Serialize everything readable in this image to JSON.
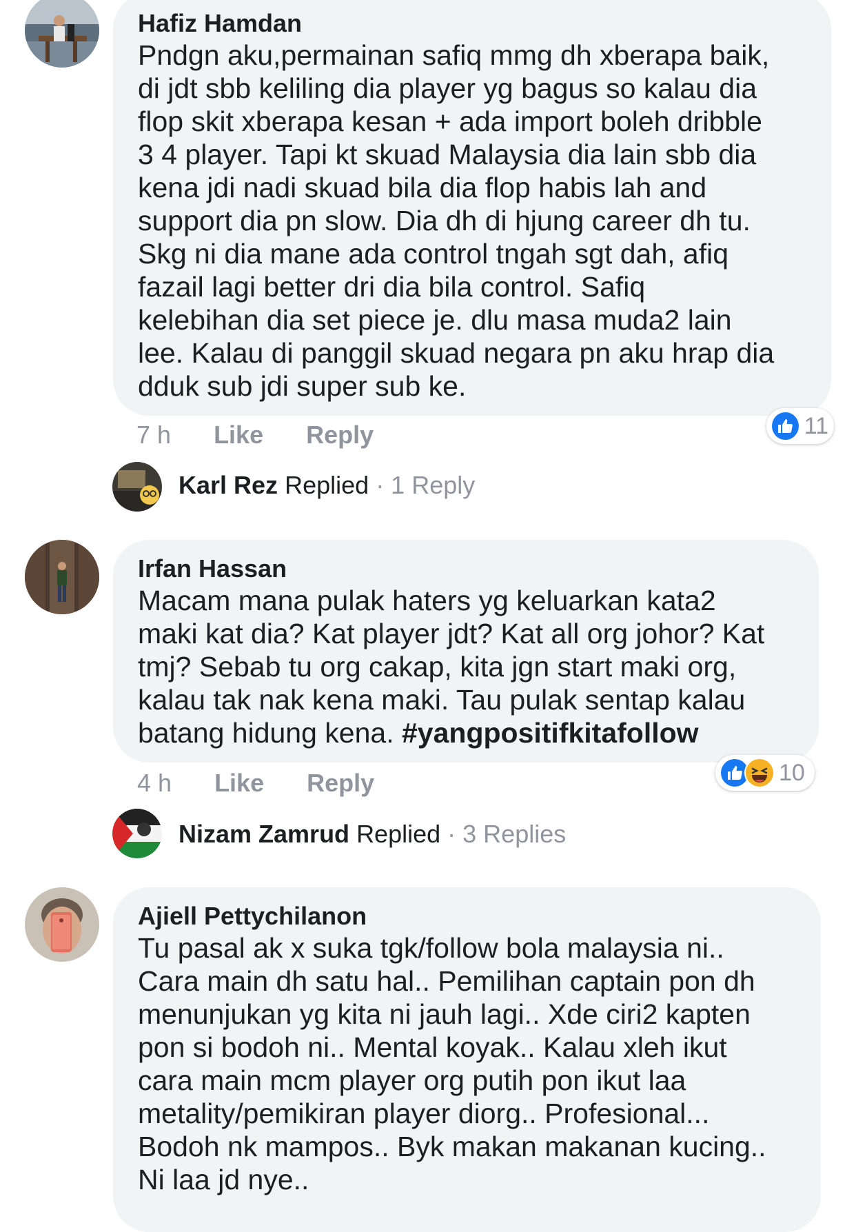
{
  "comments": [
    {
      "author": "Hafiz Hamdan",
      "text": "Pndgn aku,permainan safiq mmg dh xberapa baik,\ndi jdt sbb keliling dia player yg bagus so kalau dia\nflop skit xberapa kesan + ada import boleh dribble\n3 4 player. Tapi kt skuad Malaysia dia lain sbb dia\nkena jdi nadi skuad bila dia flop habis lah and\nsupport dia pn slow. Dia dh di hjung career dh tu.\nSkg ni dia mane ada control tngah sgt dah, afiq\nfazail lagi better dri dia bila control. Safiq\nkelebihan dia set piece je. dlu masa muda2 lain\nlee. Kalau di panggil skuad negara pn aku hrap dia\ndduk sub jdi super sub ke.",
      "time": "7 h",
      "like_label": "Like",
      "reply_label": "Reply",
      "reaction_count": "11",
      "reactions": [
        "like-icon"
      ],
      "replied": {
        "name": "Karl Rez",
        "word": "Replied",
        "count": "· 1 Reply"
      }
    },
    {
      "author": "Irfan Hassan",
      "text": "Macam mana pulak haters yg keluarkan kata2\nmaki kat dia? Kat player jdt? Kat all org johor? Kat\ntmj? Sebab tu org cakap, kita jgn start maki org,\nkalau tak nak kena maki. Tau pulak sentap kalau\nbatang hidung kena. ",
      "hashtag": "#yangpositifkitafollow",
      "time": "4 h",
      "like_label": "Like",
      "reply_label": "Reply",
      "reaction_count": "10",
      "reactions": [
        "like-icon",
        "haha-icon"
      ],
      "replied": {
        "name": "Nizam Zamrud",
        "word": "Replied",
        "count": "· 3 Replies"
      }
    },
    {
      "author": "Ajiell Pettychilanon",
      "text": "Tu pasal ak x suka tgk/follow bola malaysia ni..\nCara main dh satu hal.. Pemilihan captain pon dh\nmenunjukan yg kita ni jauh lagi.. Xde ciri2 kapten\npon si bodoh ni.. Mental koyak.. Kalau xleh ikut\ncara main mcm player org putih pon ikut laa\nmetality/pemikiran player diorg.. Profesional...\nBodoh nk mampos.. Byk makan makanan kucing..\nNi laa jd nye.."
    }
  ],
  "colors": {
    "bubble": "#f2f3f5",
    "meta": "#90949c",
    "like_blue": "#1877f2",
    "haha_yellow": "#f7b125"
  }
}
